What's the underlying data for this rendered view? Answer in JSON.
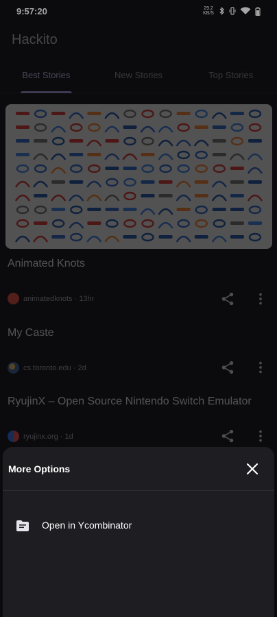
{
  "status_bar": {
    "time": "9:57:20",
    "net_speed": "29.2 KB/S"
  },
  "app": {
    "title": "Hackito"
  },
  "tabs": [
    {
      "label": "Best Stories",
      "active": true
    },
    {
      "label": "New Stories",
      "active": false
    },
    {
      "label": "Top Stories",
      "active": false
    }
  ],
  "stories": [
    {
      "title": "Animated Knots",
      "source": "animatedknots · 13hr",
      "favicon_color": "#d94a3a"
    },
    {
      "title": "My Caste",
      "source": "cs.toronto.edu · 2d",
      "favicon_color": "#4a6fa5"
    },
    {
      "title": "RyujinX – Open Source Nintendo Switch Emulator",
      "source": "ryujinx.org · 1d",
      "favicon_color": "#3c6fd6"
    }
  ],
  "sheet": {
    "title": "More Options",
    "items": [
      {
        "label": "Open in Ycombinator",
        "icon": "document-folder-icon"
      }
    ]
  },
  "colors": {
    "background": "#111114",
    "accent": "#9d97d8",
    "sheet": "#1d1d22"
  }
}
